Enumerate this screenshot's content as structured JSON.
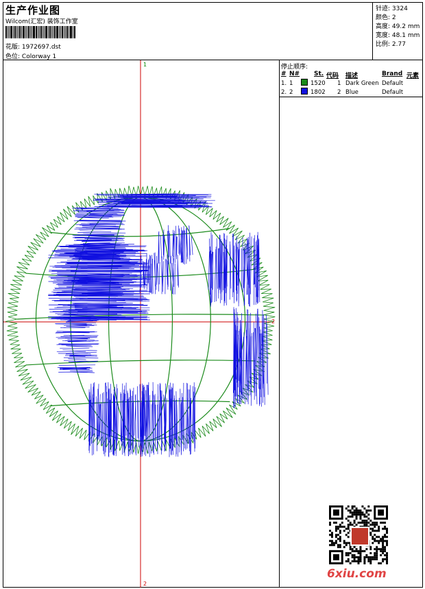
{
  "header": {
    "title": "生产作业图",
    "studio": "Wilcom(汇宏) 装饰工作室",
    "design_label": "花版:",
    "design_value": "1972697.dst",
    "colorway_label": "色位:",
    "colorway_value": "Colorway 1"
  },
  "stats": {
    "stitches_label": "针迹:",
    "stitches_value": "3324",
    "colors_label": "颜色:",
    "colors_value": "2",
    "height_label": "高度:",
    "height_value": "49.2 mm",
    "width_label": "宽度:",
    "width_value": "48.1 mm",
    "ratio_label": "比例:",
    "ratio_value": "2.77"
  },
  "stop_sequence": {
    "title": "停止顺序:",
    "headers": {
      "hash": "#",
      "no": "N#",
      "st": "St.",
      "code": "代码",
      "desc": "描述",
      "brand": "Brand",
      "elem": "元素"
    },
    "rows": [
      {
        "hash": "1.",
        "no": "1",
        "color": "#1a8a1a",
        "st": "1520",
        "code": "1",
        "desc": "Dark Green",
        "brand": "Default"
      },
      {
        "hash": "2.",
        "no": "2",
        "color": "#1010e0",
        "st": "1802",
        "code": "2",
        "desc": "Blue",
        "brand": "Default"
      }
    ]
  },
  "axis_markers": {
    "top": "1",
    "bottom": "2",
    "right": "2"
  },
  "watermark": {
    "text": "6xiu.com",
    "color": "#e04444"
  },
  "embroidery_colors": {
    "green": "#1a8a1a",
    "blue": "#1010e0",
    "axis": "#cc0000"
  }
}
